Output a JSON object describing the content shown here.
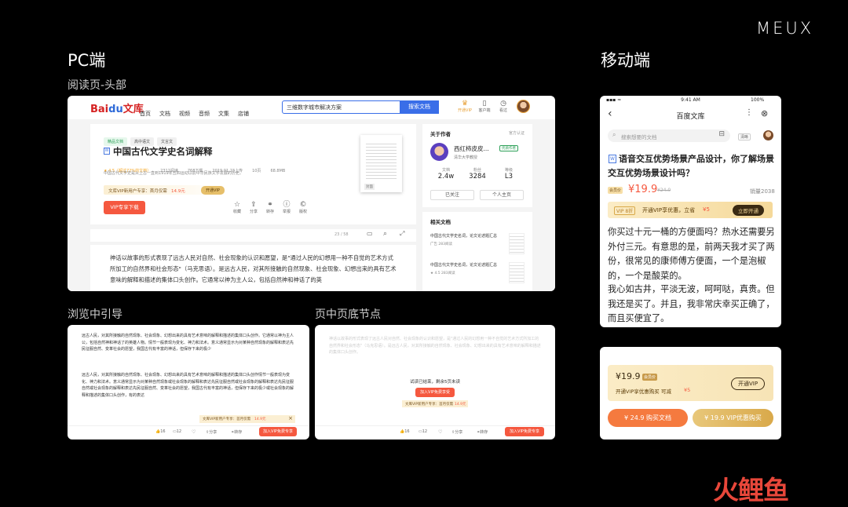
{
  "brand": "MEUX",
  "watermark": "火鲤鱼",
  "pc": {
    "title": "PC端",
    "subtitle": "阅读页-头部",
    "logo_bai": "Bai",
    "logo_paw": "du",
    "logo_wenku": "文库",
    "nav": [
      "首页",
      "文档",
      "视频",
      "音频",
      "文集",
      "店铺"
    ],
    "search_value": "三维数字城市解决方案",
    "search_button": "搜索文档",
    "header_icons": [
      {
        "icon": "vip-crown-icon",
        "glyph": "♛",
        "label": "开通VIP"
      },
      {
        "icon": "phone-icon",
        "glyph": "▯",
        "label": "客户端"
      },
      {
        "icon": "clock-icon",
        "glyph": "◷",
        "label": "看过"
      }
    ],
    "tags": [
      "精品文档",
      "高中语文",
      "文言文"
    ],
    "doc_title": "中国古代文学史名词解释",
    "meta": [
      "★ 4.5（超过72%的文档）",
      "2312阅读",
      "768下载",
      "2019.01.23上传",
      "10页",
      "68.8MB"
    ],
    "description": "中国古代文学史是从上古一直到1919年五四运动以前中华民族文学发展的历史。",
    "promo_text": "文库VIP新用户专享：首月仅需",
    "promo_price": "14.9元",
    "promo_button": "开通VIP",
    "vip_download": "VIP专享下载",
    "actions": [
      {
        "glyph": "☆",
        "label": "收藏",
        "icon": "star-icon"
      },
      {
        "glyph": "⇪",
        "label": "分享",
        "icon": "share-icon"
      },
      {
        "glyph": "⚭",
        "label": "转存",
        "icon": "save-icon"
      },
      {
        "glyph": "ⓘ",
        "label": "举报",
        "icon": "report-icon"
      },
      {
        "glyph": "©",
        "label": "版权",
        "icon": "copyright-icon"
      }
    ],
    "thumb_label": "封面",
    "pager": "23  /  58",
    "about_author": "关于作者",
    "official": "官方认证",
    "author_name": "西红柿皮皮...",
    "author_badge": "优质作者",
    "author_org": "清华大学教授",
    "stats": [
      {
        "label": "文档",
        "value": "2.4w"
      },
      {
        "label": "粉丝",
        "value": "3284"
      },
      {
        "label": "等级",
        "value": "L3"
      }
    ],
    "follow_button": "已关注",
    "homepage_button": "个人主页",
    "related_title": "相关文档",
    "related": [
      {
        "title": "中国古代文学史名词，论文论述题汇总",
        "meta": "广告    283阅读"
      },
      {
        "title": "中国古代文学史名词，论文论述题汇总",
        "meta": "★ 4.5    283阅读"
      }
    ],
    "paragraph": "神话以故事的形式表现了远古人民对自然、社会现象的认识和愿望，是\"通过人民的幻想用一种不自觉的艺术方式所加工的自然界和社会形态\"（马克思语）。是远古人民，对其所接触的自然现象、社会现象、幻想出来的具有艺术意味的解释和描述的集体口头创作。它通常以神为主人公，包括自然神和神话了的英"
  },
  "guide": {
    "title": "浏览中引导",
    "para1": "远古人民，对其所接触的自然现象、社会现象、幻想出来的具有艺术意味的解释和描述的集体口头创作。它通常以神为主人公，包括自然神和神话了的英雄人物。情节一般表现为变化、神力和法术。意义通常显示为对某种自然现象的解释和表达先民征服自然、变革社会的愿望，我国古代有丰富的神话，但保存下来的极少",
    "para2": "远古人民，对其所接触的自然现象、社会现象、幻想出来的具有艺术意味的解释和描述的集体口头创作情节一般表现为变化、神力和法术。意义通常显示为对某种自然现象或社会现象的解释和表达先民征服自然或社会现象的解释和表达先民征服自然或社会现象的解释和表达先民征服自然、变革社会的愿望，我国古代有丰富的神话，但保存下来的极少或社会现象的解释和描述的集体口头创作，有的表达",
    "tip": "文库VIP新用户专享：首月仅需",
    "tip_price": "14.9元",
    "bar": [
      "16",
      "12",
      "",
      "分享",
      "转存"
    ],
    "bar_button": "加入VIP免费专享"
  },
  "bottom": {
    "title": "页中页底节点",
    "para": "神话以故事的形式表现了远古人民对自然、社会现象的认识和愿望，是\"通过人民的幻想用一种不自觉的艺术方式所加工的自然界和社会形态\"（马克思语）。是远古人民，对其所接触的自然现象、社会现象、幻想出来的具有艺术意味的解释和描述的集体口头创作。",
    "trial": "试读已结束，剩余5页未读",
    "join": "加入VIP免费享受",
    "tip": "文库VIP新用户专享：首月仅需",
    "tip_price": "14.9元",
    "bar": [
      "16",
      "12",
      "",
      "分享",
      "转存"
    ],
    "bar_button": "加入VIP免费专享"
  },
  "mobile": {
    "title": "移动端",
    "time": "9:41 AM",
    "battery": "100%",
    "app_title": "百度文库",
    "search_placeholder": "搜索想要的文档",
    "search_tag": "清晰",
    "doc_title": "语音交互优势场景产品设计，你了解场景交互优势场景设计吗？",
    "member_tag": "会员价",
    "price": "¥19.9",
    "old_price": "¥24.0",
    "sales": "销量2038",
    "vip_tag": "VIP 8折",
    "vip_text": "开通VIP享优惠，立省",
    "vip_save": "¥5",
    "vip_button": "立即开通",
    "para1": "你买过十元一桶的方便面吗？热水还需要另外付三元。有意思的是，前两天我才买了两份，很常见的康师傅方便面，一个是泡椒的，一个是酸菜的。",
    "para2": "我心如古井，平淡无波，呵呵哒，真贵。但我还是买了。并且，我非常庆幸买正确了，而且买便宜了。",
    "bottom_price": "¥19.9",
    "bottom_member": "会员价",
    "bottom_vip_text": "开通VIP享优惠购买 可减",
    "bottom_save": "¥5",
    "bottom_vip_button": "开通VIP",
    "buy_button": "¥ 24.9 购买文档",
    "vip_buy_button": "¥ 19.9 VIP优惠购买"
  }
}
